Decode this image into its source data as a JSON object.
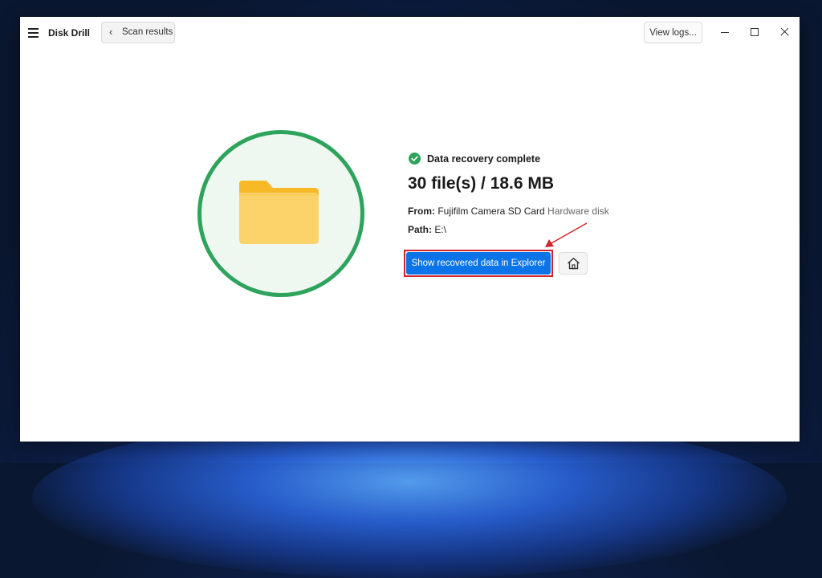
{
  "window": {
    "app_title": "Disk Drill",
    "back_button_label": "Scan results",
    "view_logs_label": "View logs..."
  },
  "result": {
    "status": "Data recovery complete",
    "summary": "30 file(s) / 18.6 MB",
    "from_label": "From:",
    "from_value": "Fujifilm Camera SD Card",
    "from_type": "Hardware disk",
    "path_label": "Path:",
    "path_value": "E:\\",
    "primary_action": "Show recovered data in Explorer"
  },
  "icons": [
    "hamburger-icon",
    "chevron-left-icon",
    "minimize-icon",
    "maximize-icon",
    "close-icon",
    "folder-icon",
    "check-circle-icon",
    "home-icon",
    "annotation-arrow"
  ],
  "colors": {
    "accent": "#0a74e8",
    "success": "#2ea35c",
    "annotation": "#d0252c",
    "folder": "#fcd26a"
  }
}
